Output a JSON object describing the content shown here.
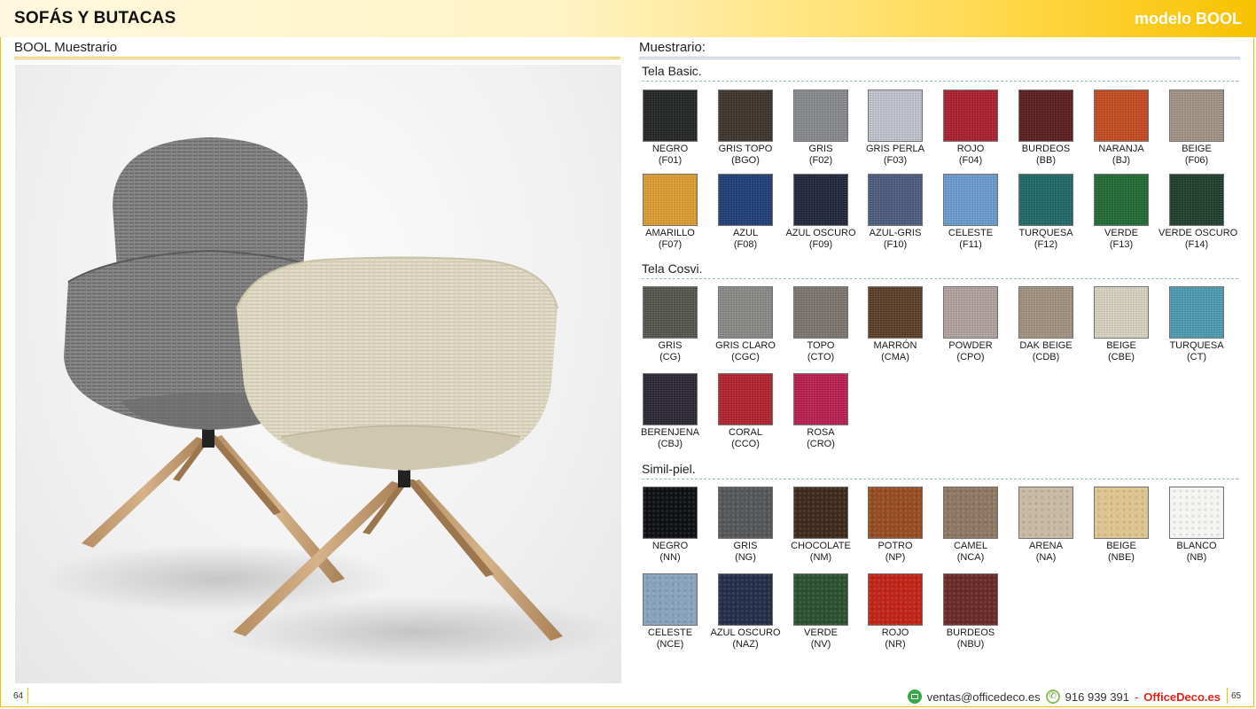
{
  "header": {
    "title": "SOFÁS Y BUTACAS",
    "model": "modelo BOOL"
  },
  "left": {
    "heading": "BOOL Muestrario"
  },
  "right": {
    "heading": "Muestrario:"
  },
  "sections": {
    "basic": {
      "title": "Tela Basic.",
      "items": [
        {
          "name": "NEGRO",
          "code": "(F01)",
          "color": "#1e2020"
        },
        {
          "name": "GRIS TOPO",
          "code": "(BGO)",
          "color": "#3a3028"
        },
        {
          "name": "GRIS",
          "code": "(F02)",
          "color": "#8a8c90"
        },
        {
          "name": "GRIS PERLA",
          "code": "(F03)",
          "color": "#c8ccd6"
        },
        {
          "name": "ROJO",
          "code": "(F04)",
          "color": "#b0182a"
        },
        {
          "name": "BURDEOS",
          "code": "(BB)",
          "color": "#5a1618"
        },
        {
          "name": "NARANJA",
          "code": "(BJ)",
          "color": "#cc4818"
        },
        {
          "name": "BEIGE",
          "code": "(F06)",
          "color": "#a89888"
        },
        {
          "name": "AMARILLO",
          "code": "(F07)",
          "color": "#eaa22e"
        },
        {
          "name": "AZUL",
          "code": "(F08)",
          "color": "#1a3a78"
        },
        {
          "name": "AZUL OSCURO",
          "code": "(F09)",
          "color": "#1a2038"
        },
        {
          "name": "AZUL-GRIS",
          "code": "(F10)",
          "color": "#4a5a80"
        },
        {
          "name": "CELESTE",
          "code": "(F11)",
          "color": "#6aa0d8"
        },
        {
          "name": "TURQUESA",
          "code": "(F12)",
          "color": "#1a6868"
        },
        {
          "name": "VERDE",
          "code": "(F13)",
          "color": "#1a6a30"
        },
        {
          "name": "VERDE OSCURO",
          "code": "(F14)",
          "color": "#1a3a28"
        }
      ]
    },
    "cosvi": {
      "title": "Tela Cosvi.",
      "items": [
        {
          "name": "GRIS",
          "code": "(CG)",
          "color": "#54544c"
        },
        {
          "name": "GRIS CLARO",
          "code": "(CGC)",
          "color": "#8c8c8a"
        },
        {
          "name": "TOPO",
          "code": "(CTO)",
          "color": "#7e7670"
        },
        {
          "name": "MARRÓN",
          "code": "(CMA)",
          "color": "#5a3a22"
        },
        {
          "name": "POWDER",
          "code": "(CPO)",
          "color": "#b8a8a4"
        },
        {
          "name": "DAK BEIGE",
          "code": "(CDB)",
          "color": "#a89682"
        },
        {
          "name": "BEIGE",
          "code": "(CBE)",
          "color": "#e2dcc8"
        },
        {
          "name": "TURQUESA",
          "code": "(CT)",
          "color": "#4aa0b8"
        },
        {
          "name": "BERENJENA",
          "code": "(CBJ)",
          "color": "#262230"
        },
        {
          "name": "CORAL",
          "code": "(CCO)",
          "color": "#b81c2a"
        },
        {
          "name": "ROSA",
          "code": "(CRO)",
          "color": "#c01a50"
        }
      ]
    },
    "simil": {
      "title": "Simil-piel.",
      "items": [
        {
          "name": "NEGRO",
          "code": "(NN)",
          "color": "#0e1014"
        },
        {
          "name": "GRIS",
          "code": "(NG)",
          "color": "#545658"
        },
        {
          "name": "CHOCOLATE",
          "code": "(NM)",
          "color": "#3e2a1c"
        },
        {
          "name": "POTRO",
          "code": "(NP)",
          "color": "#964c22"
        },
        {
          "name": "CAMEL",
          "code": "(NCA)",
          "color": "#8e7662"
        },
        {
          "name": "ARENA",
          "code": "(NA)",
          "color": "#c8b8a4"
        },
        {
          "name": "BEIGE",
          "code": "(NBE)",
          "color": "#dcc48c"
        },
        {
          "name": "BLANCO",
          "code": "(NB)",
          "color": "#f4f4f2"
        },
        {
          "name": "CELESTE",
          "code": "(NCE)",
          "color": "#86a2bc"
        },
        {
          "name": "AZUL OSCURO",
          "code": "(NAZ)",
          "color": "#242e48"
        },
        {
          "name": "VERDE",
          "code": "(NV)",
          "color": "#2a5030"
        },
        {
          "name": "ROJO",
          "code": "(NR)",
          "color": "#c02418"
        },
        {
          "name": "BURDEOS",
          "code": "(NBU)",
          "color": "#6a2a28"
        }
      ]
    }
  },
  "footer": {
    "page_left": "64",
    "page_right": "65",
    "email": "ventas@officedeco.es",
    "phone": "916 939 391",
    "separator": "-",
    "brand": "OfficeDeco.es"
  },
  "icons": {
    "mail": "mail-icon",
    "phone": "phone-icon"
  }
}
